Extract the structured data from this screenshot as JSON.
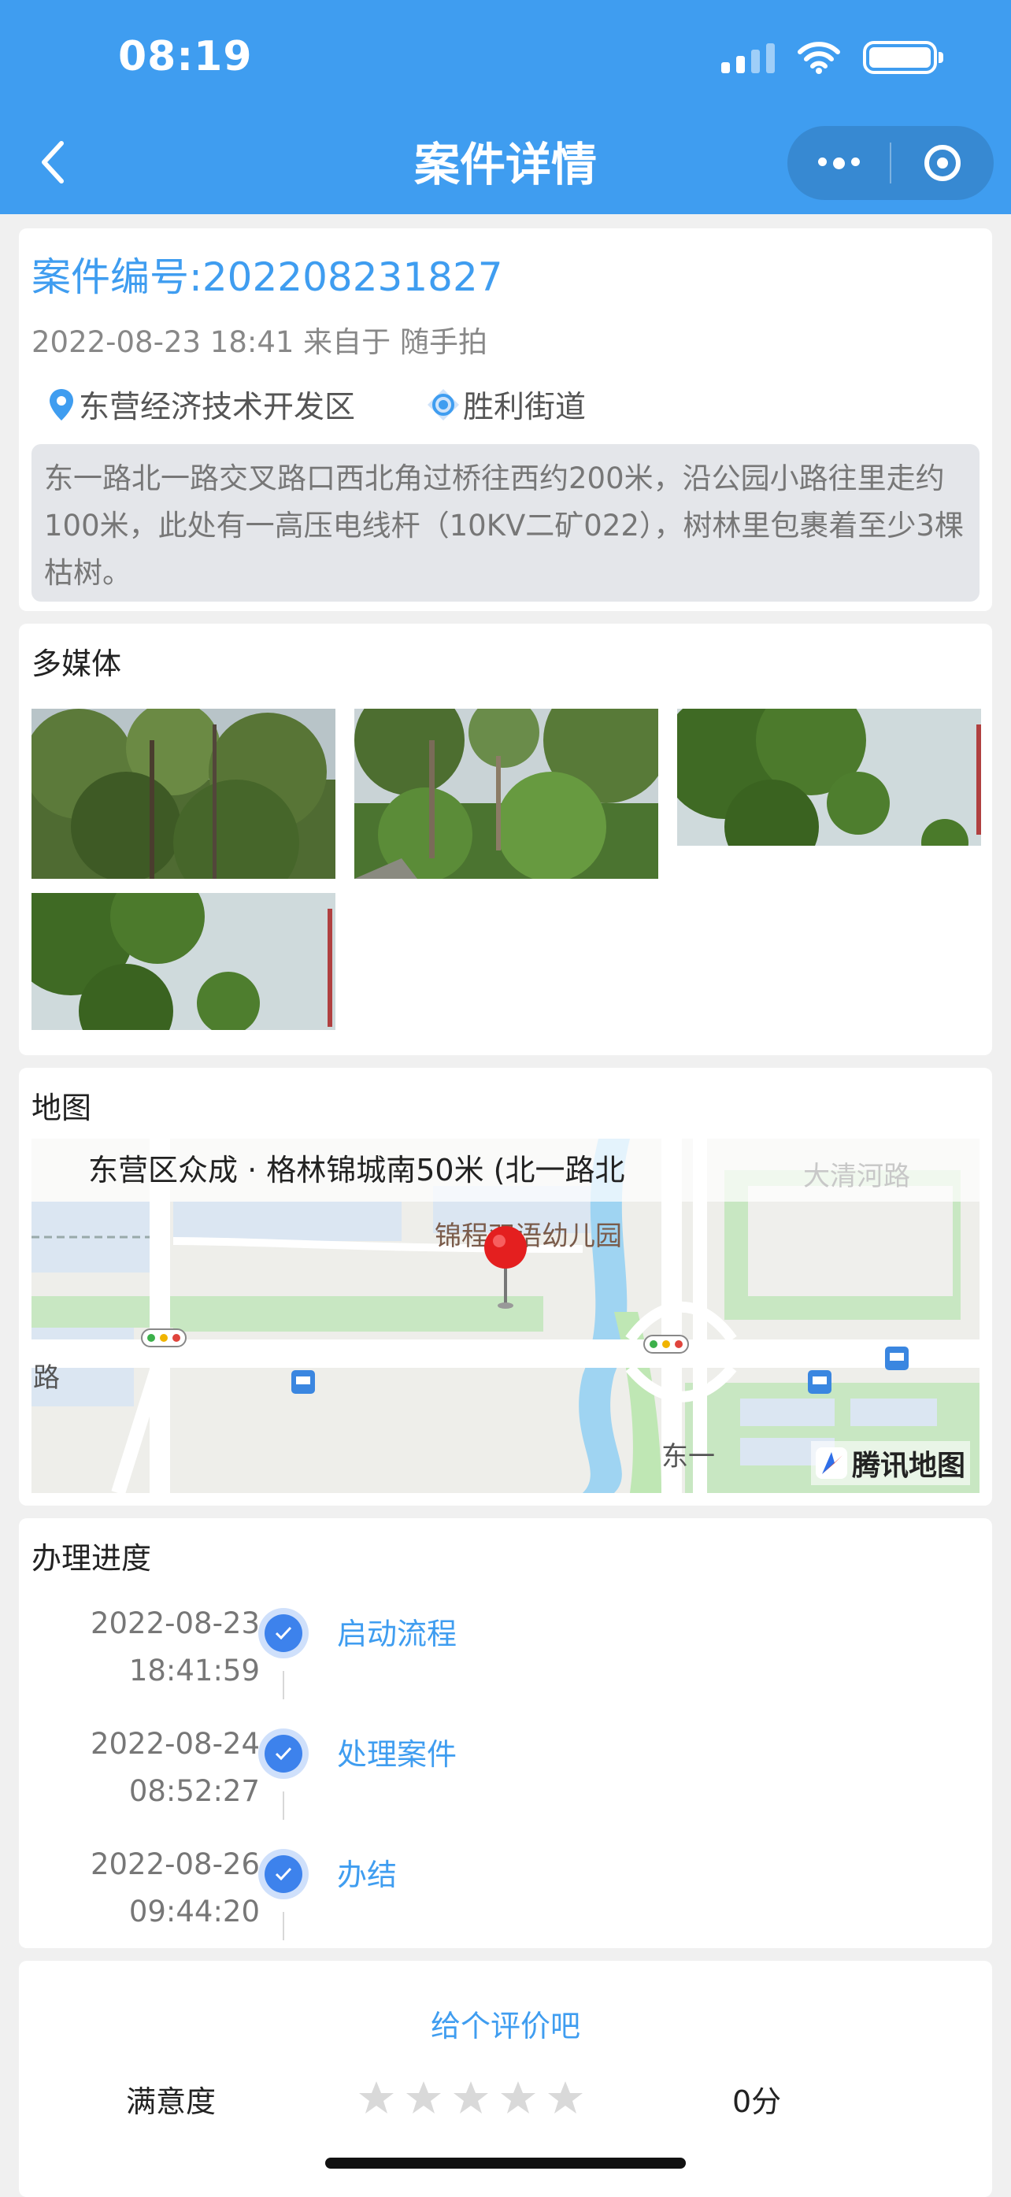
{
  "status_bar": {
    "time": "08:19"
  },
  "nav": {
    "title": "案件详情"
  },
  "case": {
    "number": "案件编号:202208231827",
    "meta": "2022-08-23 18:41 来自于 随手拍",
    "district": "东营经济技术开发区",
    "street": "胜利街道",
    "description": "东一路北一路交叉路口西北角过桥往西约200米，沿公园小路往里走约100米，此处有一高压电线杆（10KV二矿022），树林里包裹着至少3棵枯树。"
  },
  "media": {
    "title": "多媒体",
    "photos": [
      "tree-photo-1",
      "tree-photo-2",
      "tree-photo-3",
      "tree-photo-4"
    ]
  },
  "map": {
    "title": "地图",
    "address": "东营区众成 · 格林锦城南50米 (北一路北",
    "poi_kindergarten": "锦程双语幼儿园",
    "poi_river": "大清河路",
    "road_left": "路",
    "road_east": "东一",
    "brand": "腾讯地图"
  },
  "progress": {
    "title": "办理进度",
    "steps": [
      {
        "date": "2022-08-23",
        "time": "18:41:59",
        "label": "启动流程"
      },
      {
        "date": "2022-08-24",
        "time": "08:52:27",
        "label": "处理案件"
      },
      {
        "date": "2022-08-26",
        "time": "09:44:20",
        "label": "办结"
      }
    ]
  },
  "rating": {
    "prompt": "给个评价吧",
    "label": "满意度",
    "stars_filled": 0,
    "stars_total": 5,
    "score": "0分"
  },
  "colors": {
    "accent": "#3f9df0",
    "check": "#3d82ec",
    "background": "#f0f0f0"
  }
}
